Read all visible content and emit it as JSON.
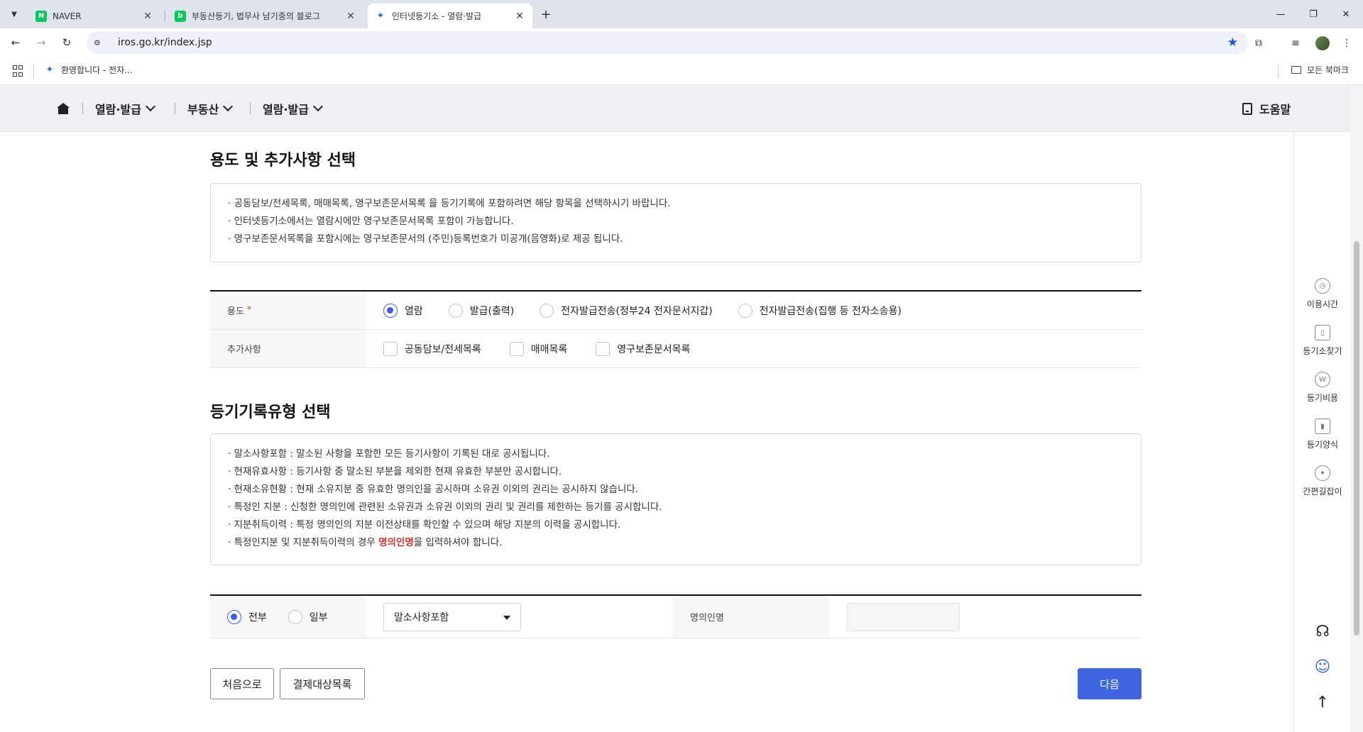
{
  "browser": {
    "tabs": [
      {
        "title": "NAVER",
        "favicon": "N",
        "favicon_color": "#03c75a",
        "active": false
      },
      {
        "title": "부동산등기, 법무사 남기중의 블로그",
        "favicon": "b",
        "favicon_color": "#03c75a",
        "active": false
      },
      {
        "title": "인터넷등기소 - 열람·발급",
        "favicon": "✦",
        "favicon_color": "#2b6ad4",
        "active": true
      }
    ],
    "new_tab_icon": "+",
    "url": "iros.go.kr/index.jsp",
    "bookmarks": {
      "item": "환영합니다 - 전자...",
      "all_bookmarks": "모든 북마크"
    }
  },
  "site_nav": {
    "menus": [
      "열람·발급",
      "부동산",
      "열람·발급"
    ],
    "help": "도움말"
  },
  "right_rail": {
    "items": [
      {
        "label": "이용시간",
        "icon": "clock-icon",
        "glyph": "◷"
      },
      {
        "label": "등기소찾기",
        "icon": "map-book-icon",
        "glyph": "▯"
      },
      {
        "label": "등기비용",
        "icon": "won-icon",
        "glyph": "W"
      },
      {
        "label": "등기양식",
        "icon": "form-icon",
        "glyph": "▮"
      },
      {
        "label": "간편길잡이",
        "icon": "compass-icon",
        "glyph": "✦"
      }
    ],
    "headset_glyph": "☊",
    "chatbot_glyph": "☺",
    "top_glyph": "↑"
  },
  "section1": {
    "title": "용도 및 추가사항 선택",
    "notes": [
      "· 공동담보/전세목록, 매매목록, 영구보존문서목록 을 등기기록에 포함하려면 해당 항목을 선택하시기 바랍니다.",
      "· 인터넷등기소에서는 열람시에만 영구보존문서목록 포함이 가능합니다.",
      "· 영구보존문서목록을 포함시에는 영구보존문서의 (주민)등록번호가 미공개(음영화)로 제공 됩니다."
    ],
    "purpose_label": "용도",
    "required_mark": "*",
    "purpose_options": [
      "열람",
      "발급(출력)",
      "전자발급전송(정부24 전자문서지갑)",
      "전자발급전송(집행 등 전자소송용)"
    ],
    "purpose_selected": 0,
    "extra_label": "추가사항",
    "extra_options": [
      "공동담보/전세목록",
      "매매목록",
      "영구보존문서목록"
    ]
  },
  "section2": {
    "title": "등기기록유형 선택",
    "notes": [
      "· 말소사항포함 : 말소된 사항을 포함한 모든 등기사항이 기록된 대로 공시됩니다.",
      "· 현재유효사항 : 등기사항 중 말소된 부분을 제외한 현재 유효한 부분만 공시합니다.",
      "· 현재소유현황 : 현재 소유지분 중 유효한 명의인을 공시하며 소유권 이외의 권리는 공시하지 않습니다.",
      "· 특정인 지분 : 신청한 명의인에 관련된 소유권과 소유권 이외의 권리 및 권리를 제한하는 등기를 공시합니다.",
      "· 지분취득이력 : 특정 명의인의 지분 이전상태를 확인할 수 있으며 해당 지분의 이력을 공시합니다."
    ],
    "last_note_before": "· 특정인지분 및 지분취득이력의 경우 ",
    "last_note_red": "명의인명",
    "last_note_after": "을 입력하셔야 합니다.",
    "scope_options": [
      "전부",
      "일부"
    ],
    "scope_selected": 0,
    "record_type_value": "말소사항포함",
    "name_label": "명의인명",
    "name_value": ""
  },
  "buttons": {
    "home": "처음으로",
    "payment_list": "결제대상목록",
    "next": "다음"
  }
}
